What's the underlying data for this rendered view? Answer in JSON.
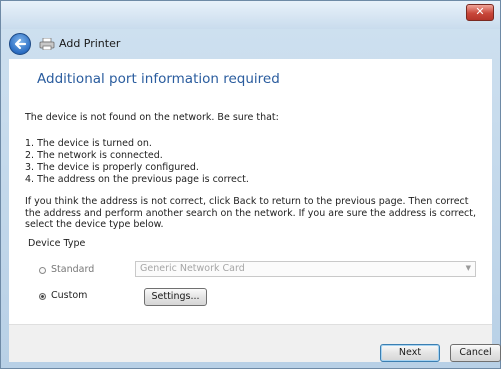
{
  "window": {
    "close_glyph": "✕"
  },
  "nav": {
    "title": "Add Printer",
    "back_icon": "back-arrow-icon",
    "printer_icon": "printer-icon"
  },
  "content": {
    "heading": "Additional port information required",
    "intro": "The device is not found on the network.  Be sure that:",
    "checklist": [
      "1.  The device is turned on.",
      "2.  The network is connected.",
      "3.  The device is properly configured.",
      "4.  The address on the previous page is correct."
    ],
    "paragraph": "If you think the address is not correct, click Back to return to the previous page.  Then correct the address and perform another search on the network.  If you are sure the address is correct, select the device type below.",
    "device_type_label": "Device Type",
    "standard_label": "Standard",
    "standard_value": "Generic Network Card",
    "standard_selected": false,
    "custom_label": "Custom",
    "custom_selected": true,
    "settings_button": "Settings..."
  },
  "footer": {
    "next_button": "Next",
    "cancel_button": "Cancel"
  },
  "colors": {
    "heading": "#2a5c9e",
    "close": "#c9473a",
    "frame": "#b8d0e6"
  }
}
